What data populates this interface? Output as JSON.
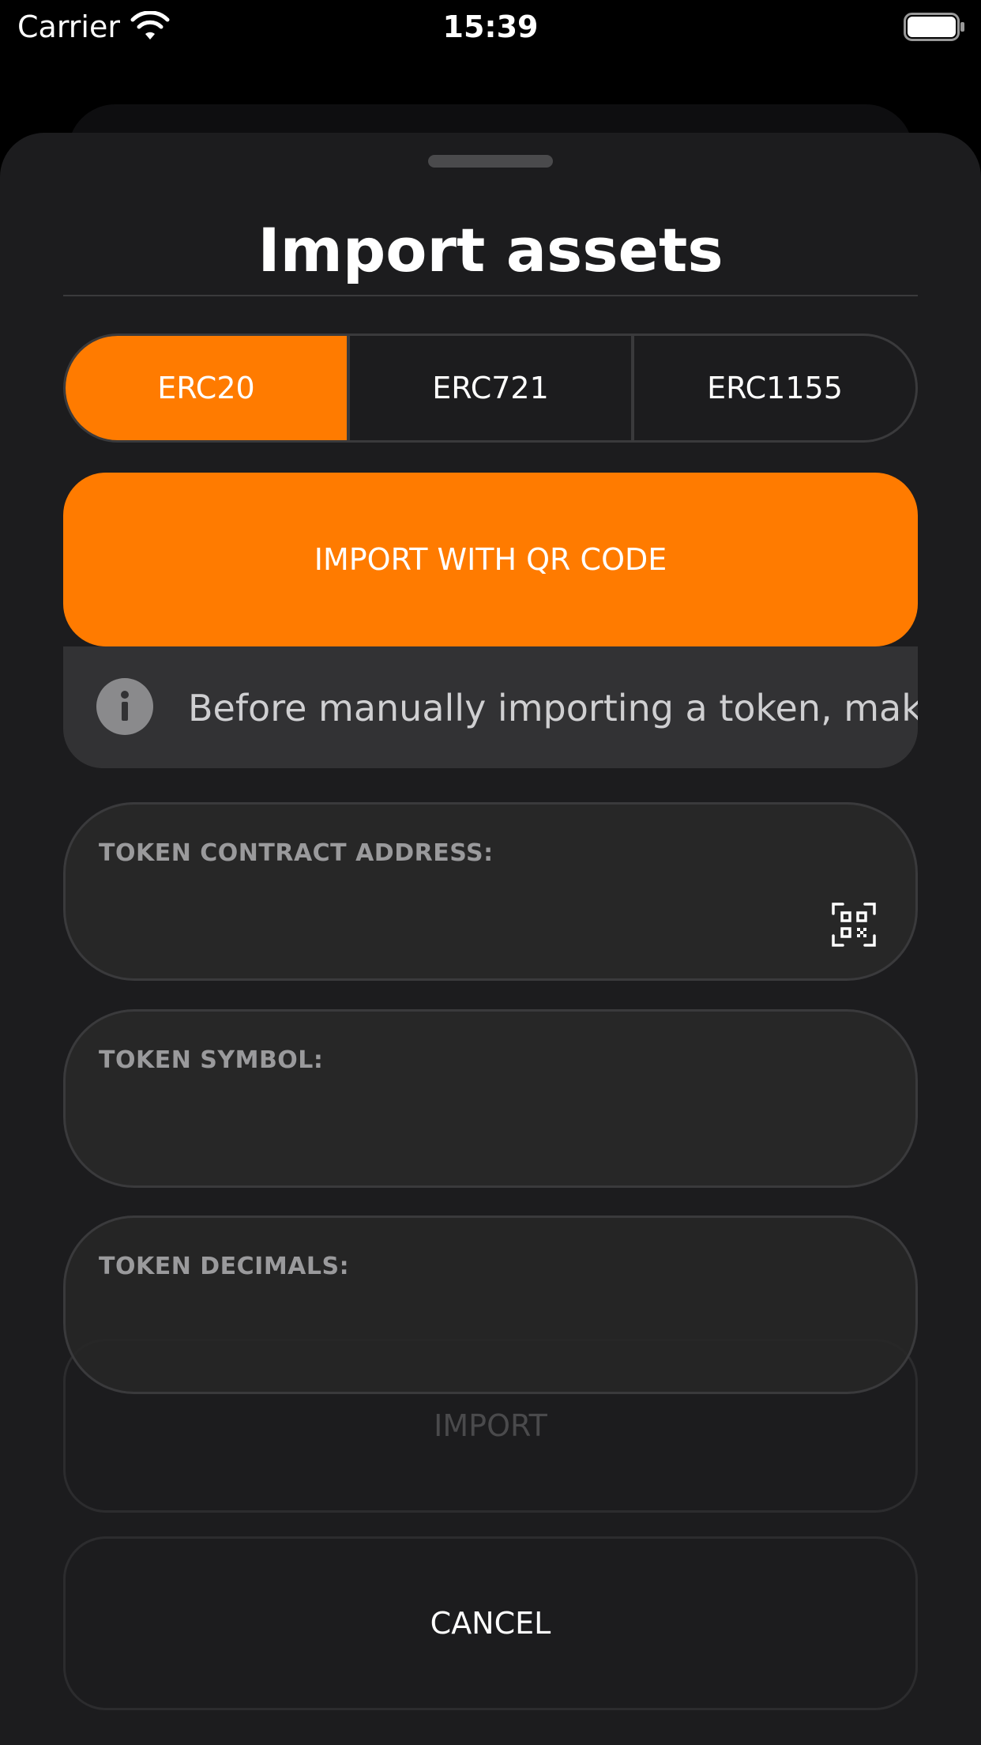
{
  "status_bar": {
    "carrier": "Carrier",
    "time": "15:39"
  },
  "sheet": {
    "title": "Import assets"
  },
  "tabs": [
    {
      "label": "ERC20",
      "selected": true
    },
    {
      "label": "ERC721",
      "selected": false
    },
    {
      "label": "ERC1155",
      "selected": false
    }
  ],
  "qr_import": {
    "label": "IMPORT WITH QR CODE"
  },
  "info": {
    "text": "Before manually importing a token, make"
  },
  "fields": {
    "contract_address": {
      "label": "TOKEN CONTRACT ADDRESS:",
      "value": ""
    },
    "symbol": {
      "label": "TOKEN SYMBOL:",
      "value": ""
    },
    "decimals": {
      "label": "TOKEN DECIMALS:",
      "value": ""
    }
  },
  "actions": {
    "import_label": "IMPORT",
    "cancel_label": "CANCEL"
  },
  "colors": {
    "accent": "#ff7b00",
    "sheet_background": "#1c1c1e",
    "field_background": "#272727"
  }
}
